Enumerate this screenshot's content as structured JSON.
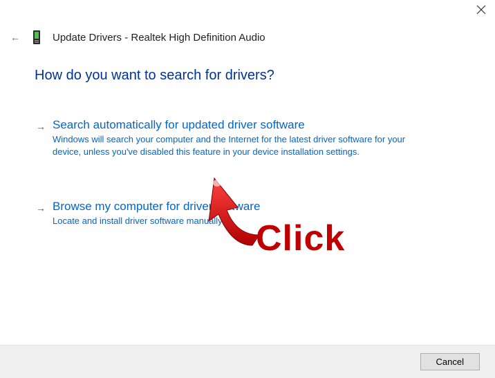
{
  "window": {
    "title": "Update Drivers - Realtek High Definition Audio"
  },
  "heading": "How do you want to search for drivers?",
  "options": [
    {
      "title": "Search automatically for updated driver software",
      "description": "Windows will search your computer and the Internet for the latest driver software for your device, unless you've disabled this feature in your device installation settings."
    },
    {
      "title": "Browse my computer for driver software",
      "description": "Locate and install driver software manually."
    }
  ],
  "buttons": {
    "cancel": "Cancel"
  },
  "annotation": {
    "label": "Click"
  }
}
